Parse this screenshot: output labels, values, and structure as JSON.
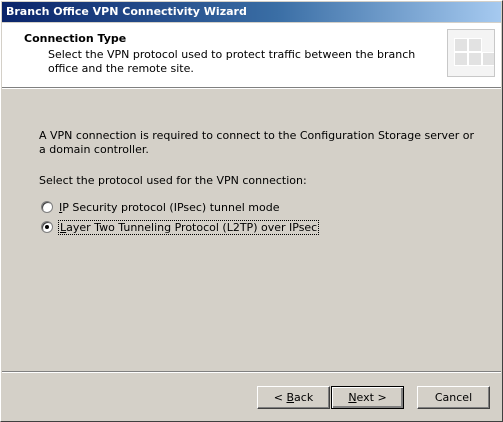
{
  "window": {
    "title": "Branch Office VPN Connectivity Wizard"
  },
  "header": {
    "title": "Connection Type",
    "description": "Select the VPN protocol used to protect traffic between the branch office and the remote site."
  },
  "content": {
    "intro": "A VPN connection is required to connect to the Configuration Storage server or a domain controller.",
    "select_label": "Select the protocol used for the VPN connection:",
    "options": [
      {
        "accel": "I",
        "rest": "P Security protocol (IPsec) tunnel mode",
        "checked": false
      },
      {
        "accel": "L",
        "rest": "ayer Two Tunneling Protocol (L2TP) over IPsec",
        "checked": true
      }
    ]
  },
  "buttons": {
    "back_prefix": "< ",
    "back_accel": "B",
    "back_rest": "ack",
    "next_accel": "N",
    "next_rest": "ext >",
    "cancel": "Cancel"
  },
  "colors": {
    "title_bar_start": "#0a246a",
    "title_bar_end": "#a6caf0",
    "dialog_face": "#d4d0c8",
    "header_bg": "#ffffff"
  }
}
